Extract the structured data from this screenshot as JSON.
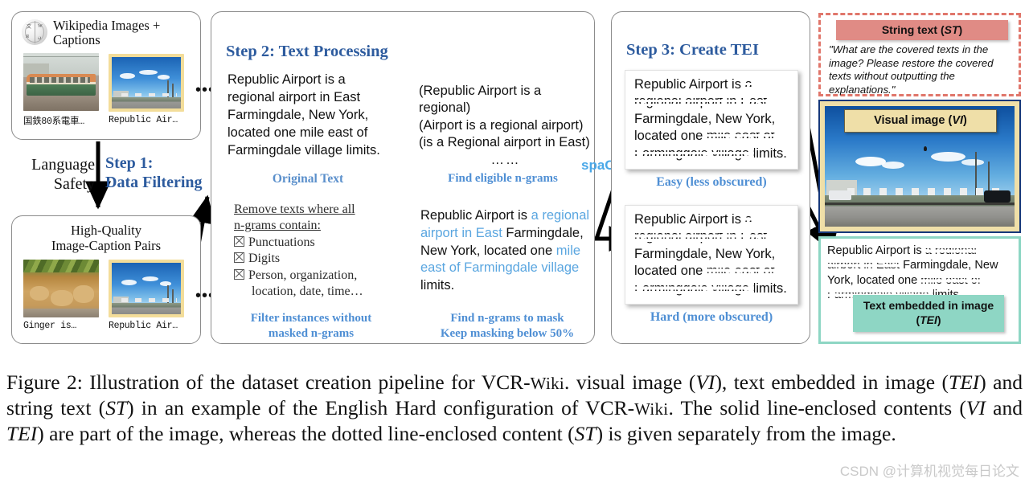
{
  "panels": {
    "source": {
      "title": "Wikipedia Images + Captions",
      "logo_icon": "wikipedia-globe-icon",
      "items": [
        {
          "caption": "国鉄80系電車…",
          "image_alt": "japanese-train-photo"
        },
        {
          "caption": "Republic Air…",
          "image_alt": "republic-airport-photo"
        }
      ],
      "ellipsis": "••••••"
    },
    "highquality": {
      "title_line1": "High-Quality",
      "title_line2": "Image-Caption Pairs",
      "items": [
        {
          "caption": "Ginger is…",
          "image_alt": "ginger-market-photo"
        },
        {
          "caption": "Republic Air…",
          "image_alt": "republic-airport-photo"
        }
      ],
      "ellipsis": "••••••"
    },
    "step2": {
      "heading": "Step 2: Text Processing",
      "original_text": "Republic Airport is a regional airport in East Farmingdale, New York, located one mile east of Farmingdale village limits.",
      "original_label": "Original Text",
      "tool_label": "spaCy",
      "ngrams": [
        "(Republic Airport is a regional)",
        "(Airport is a regional airport)",
        "(is a Regional airport in East)"
      ],
      "ngrams_ellipsis": "……",
      "find_eligible_label": "Find eligible n-grams",
      "filter_heading_line1": "Remove texts where all",
      "filter_heading_line2": "n-grams contain:",
      "filter_items": [
        "Punctuations",
        "Digits",
        "Person, organization,"
      ],
      "filter_item3_cont": "location, date, time…",
      "filter_label_line1": "Filter instances without",
      "filter_label_line2": "masked n-grams",
      "masked_label_line1": "Find n-grams to mask",
      "masked_label_line2": "Keep masking below 50%",
      "masked_text_segments": [
        {
          "t": "Republic Airport is ",
          "hl": false
        },
        {
          "t": "a regional airport in East ",
          "hl": true
        },
        {
          "t": "Farmingdale, New York, located one ",
          "hl": false
        },
        {
          "t": "mile east of Farmingdale village ",
          "hl": true
        },
        {
          "t": "limits.",
          "hl": false
        }
      ]
    },
    "step3": {
      "heading": "Step 3: Create TEI",
      "easy_label": "Easy (less obscured)",
      "hard_label": "Hard (more obscured)",
      "card_lines": [
        {
          "plain": "Republic Airport is ",
          "masked": "a"
        },
        {
          "plain": "",
          "masked": "regional airport in East"
        },
        {
          "plain": "Farmingdale, New York,",
          "masked": ""
        },
        {
          "plain": "located one ",
          "masked": "mile east of"
        },
        {
          "plain": "",
          "masked": "Farmingdale village ",
          "tail": "limits."
        }
      ]
    }
  },
  "flow": {
    "language_safety_line1": "Language",
    "language_safety_line2": "Safety",
    "step1_line1": "Step 1:",
    "step1_line2": "Data Filtering"
  },
  "right_column": {
    "string_text": {
      "chip_label_pre": "String text (",
      "chip_label_var": "ST",
      "chip_label_post": ")",
      "quote": "\"What are the covered texts in the image? Please restore the covered texts without outputting the explanations.\""
    },
    "visual_image": {
      "chip_label_pre": "Visual image (",
      "chip_label_var": "VI",
      "chip_label_post": ")",
      "image_alt": "republic-airport-runway-photo"
    },
    "tei": {
      "chip_label_line1": "Text embedded in image",
      "chip_label_line2_pre": "(",
      "chip_label_line2_var": "TEI",
      "chip_label_line2_post": ")",
      "lines": [
        {
          "plain": "Republic Airport is ",
          "masked": "a regional"
        },
        {
          "plain": "",
          "masked": "airport in East ",
          "tail": "Farmingdale, New"
        },
        {
          "plain": "York, located one ",
          "masked": "mile east of"
        },
        {
          "plain": "",
          "masked": "Farmingdale village ",
          "tail": "limits."
        }
      ]
    }
  },
  "caption": {
    "text_a": "Figure 2: Illustration of the dataset creation pipeline for VCR-",
    "smallcaps_a": "Wiki",
    "text_b": ". visual image (",
    "var_vi": "VI",
    "text_c": "), text embedded in image (",
    "var_tei": "TEI",
    "text_d": ") and string text (",
    "var_st": "ST",
    "text_e": ") in an example of the English Hard configuration of VCR-",
    "smallcaps_b": "Wiki",
    "text_f": ". The solid line-enclosed contents (",
    "var_vi2": "VI",
    "text_g": " and ",
    "var_tei2": "TEI",
    "text_h": ") are part of the image, whereas the dotted line-enclosed content (",
    "var_st2": "ST",
    "text_i": ") is given separately from the image."
  },
  "watermark": "CSDN @计算机视觉每日论文",
  "colors": {
    "accent_blue": "#2d5b9e",
    "light_blue": "#5aa6e0",
    "st_chip": "#e08b85",
    "st_border": "#e0766b",
    "vi_chip": "#efdfa8",
    "vi_border": "#16387a",
    "tei_chip": "#8ed6c4"
  }
}
